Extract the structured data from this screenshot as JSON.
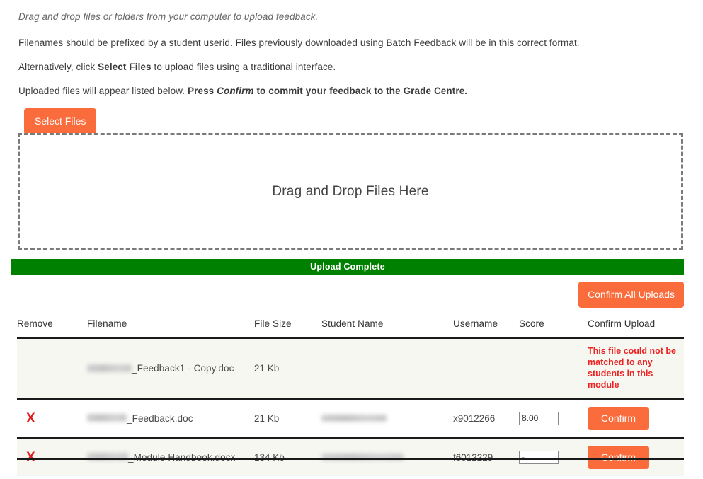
{
  "intro": {
    "tagline": "Drag and drop files or folders from your computer to upload feedback.",
    "line_prefix_note": "Filenames should be prefixed by a student userid. Files previously downloaded using Batch Feedback will be in this correct format.",
    "alt_prefix": "Alternatively, click ",
    "alt_bold": "Select Files",
    "alt_suffix": " to upload files using a traditional interface.",
    "uploaded_prefix": "Uploaded files will appear listed below. ",
    "uploaded_bold": "Press ",
    "uploaded_bold_italic": "Confirm",
    "uploaded_bold_suffix": " to commit your feedback to the Grade Centre."
  },
  "buttons": {
    "select_files": "Select Files",
    "confirm_all_uploads": "Confirm All Uploads",
    "confirm": "Confirm"
  },
  "dropzone": {
    "label": "Drag and Drop Files Here"
  },
  "status": {
    "upload_complete": "Upload Complete"
  },
  "table": {
    "headers": {
      "remove": "Remove",
      "filename": "Filename",
      "file_size": "File Size",
      "student_name": "Student Name",
      "username": "Username",
      "score": "Score",
      "confirm_upload": "Confirm Upload"
    },
    "rows": [
      {
        "remove": "",
        "filename_redacted": true,
        "filename": "_Feedback1 - Copy.doc",
        "file_size": "21 Kb",
        "student_name": "",
        "username": "",
        "score": "",
        "error": "This file could not be matched to any students in this module",
        "confirm_label": ""
      },
      {
        "remove": "X",
        "filename_redacted": true,
        "filename": "_Feedback.doc",
        "file_size": "21 Kb",
        "student_name": "",
        "username": "x9012266",
        "score": "8.00",
        "error": "",
        "confirm_label": "Confirm"
      },
      {
        "remove": "X",
        "filename_redacted": true,
        "filename": "_Module Handbook.docx",
        "file_size": "134 Kb",
        "student_name": "",
        "username": "f6012229",
        "score": "-",
        "error": "",
        "confirm_label": "Confirm"
      }
    ]
  },
  "colors": {
    "accent_orange": "#fa6c3c",
    "success_green": "#008000",
    "error_red": "#ee2222",
    "remove_red": "#e01b1b"
  }
}
